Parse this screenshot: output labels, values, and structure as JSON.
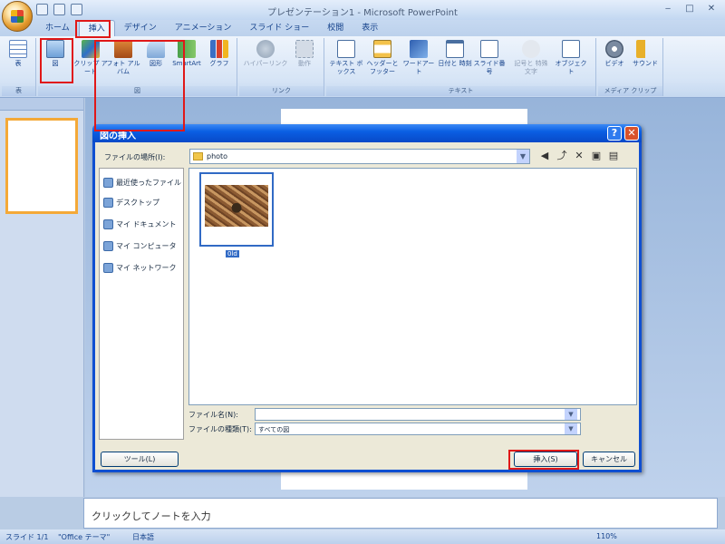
{
  "window": {
    "title": "プレゼンテーション1 - Microsoft PowerPoint"
  },
  "ribbon": {
    "tabs": [
      "ホーム",
      "挿入",
      "デザイン",
      "アニメーション",
      "スライド ショー",
      "校閲",
      "表示"
    ],
    "active_tab": "挿入",
    "groups": [
      {
        "label": "表",
        "buttons": [
          "表"
        ]
      },
      {
        "label": "図",
        "buttons": [
          "図",
          "クリップ アート",
          "フォト アルバム",
          "図形",
          "SmartArt",
          "グラフ"
        ]
      },
      {
        "label": "リンク",
        "buttons": [
          "ハイパーリンク",
          "動作"
        ]
      },
      {
        "label": "テキスト",
        "buttons": [
          "テキスト ボックス",
          "ヘッダーと フッター",
          "ワードアート",
          "日付と 時刻",
          "スライド番号",
          "記号と 特殊文字",
          "オブジェクト"
        ]
      },
      {
        "label": "メディア クリップ",
        "buttons": [
          "ビデオ",
          "サウンド"
        ]
      }
    ]
  },
  "dialog": {
    "title": "図の挿入",
    "look_in_label": "ファイルの場所(I):",
    "look_in_value": "photo",
    "places": [
      "最近使ったファイル",
      "デスクトップ",
      "マイ ドキュメント",
      "マイ コンピュータ",
      "マイ ネットワーク"
    ],
    "file_caption": "0ld",
    "filename_label": "ファイル名(N):",
    "filename_value": "",
    "filetype_label": "ファイルの種類(T):",
    "filetype_value": "すべての図",
    "tools_button": "ツール(L)",
    "insert_button": "挿入(S)",
    "cancel_button": "キャンセル"
  },
  "notes": {
    "placeholder": "クリックしてノートを入力"
  },
  "status": {
    "slide": "スライド 1/1",
    "theme": "\"Office テーマ\"",
    "language": "日本語",
    "zoom": "110%"
  },
  "colors": {
    "highlight": "#e01818",
    "dialog_title": "#0a5fe3"
  }
}
